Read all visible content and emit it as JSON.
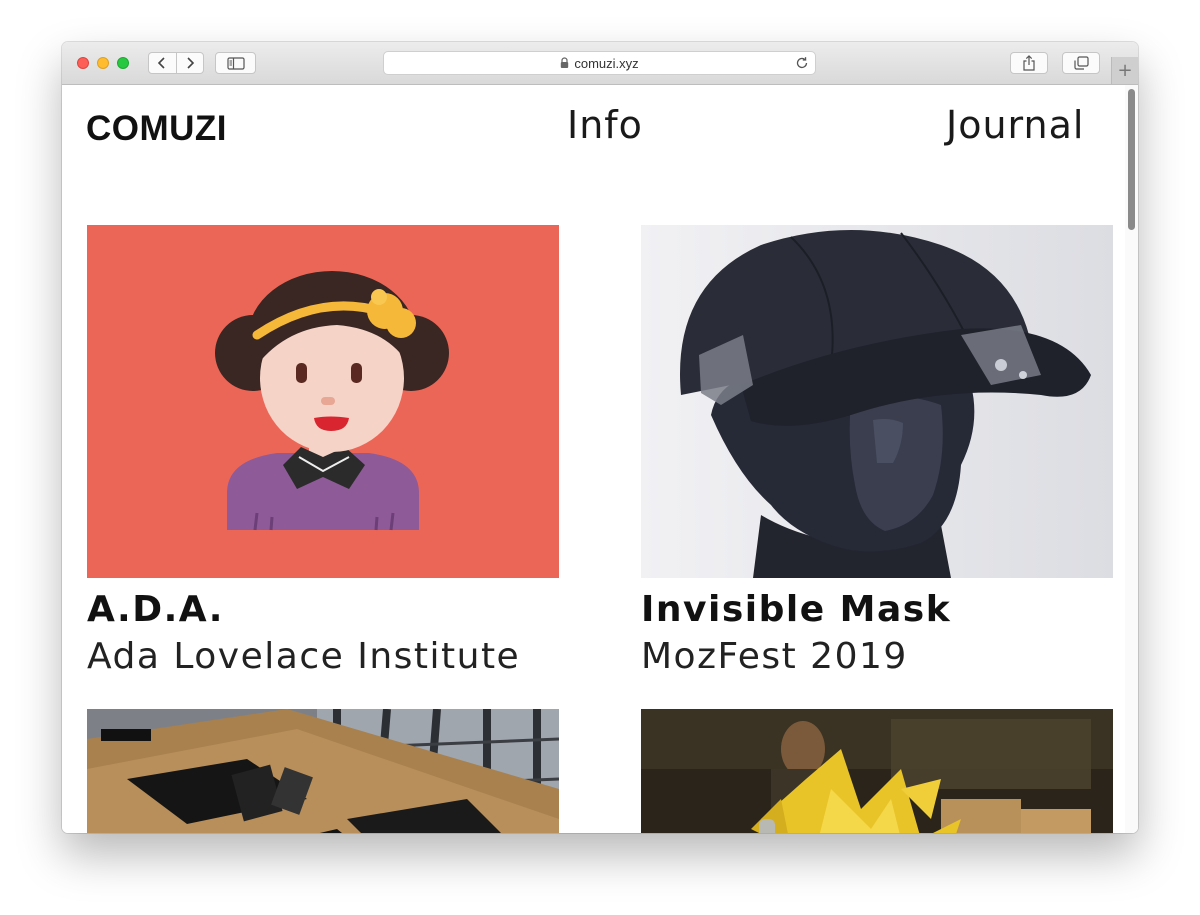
{
  "browser": {
    "url": "comuzi.xyz",
    "icons": {
      "back": "chevron-left-icon",
      "forward": "chevron-right-icon",
      "sidebar": "sidebar-icon",
      "lock": "lock-icon",
      "reload": "reload-icon",
      "share": "share-icon",
      "tabs": "tabs-overview-icon",
      "new_tab": "plus-icon"
    },
    "new_tab_glyph": "+"
  },
  "header": {
    "logo": "COMUZI",
    "nav": [
      {
        "label": "Info"
      },
      {
        "label": "Journal"
      }
    ]
  },
  "projects": [
    {
      "title": "A.D.A.",
      "subtitle": "Ada Lovelace Institute",
      "image": "ada-lovelace-illustration"
    },
    {
      "title": "Invisible Mask",
      "subtitle": "MozFest 2019",
      "image": "mannequin-head-cap-photo"
    },
    {
      "title": "",
      "subtitle": "",
      "image": "exhibition-table-photo"
    },
    {
      "title": "",
      "subtitle": "",
      "image": "yellow-paper-sculpture-photo"
    }
  ],
  "colors": {
    "ada_background": "#ec6657",
    "text": "#111111"
  }
}
